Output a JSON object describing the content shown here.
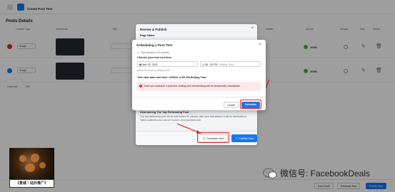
{
  "topbar": {
    "breadcrumb": "",
    "title": "Create Post Test"
  },
  "page": {
    "section_title": "Posts Details",
    "columns": [
      "Content Type",
      "Thumbnail",
      "Title",
      "Details",
      "Upload",
      "Default",
      "Edit",
      "Delete"
    ],
    "rows": [
      {
        "type": "Image",
        "upload": "100%",
        "dot_color": "#e02424"
      },
      {
        "type": "Image",
        "upload": "100%",
        "dot_color": "#1877f2"
      }
    ],
    "sub_actions": [
      "Duplicate",
      "Edit"
    ]
  },
  "review_modal": {
    "title": "Review & Publish",
    "page_name_label": "Page Name",
    "determine_title": "Determining The Top Performing Post",
    "determine_desc": "The top performing post will be determined 30 minutes after your test started. It will be distributed to Talent audiences and can be found in your published tab.",
    "schedule_label": "Schedule Test",
    "publish_label": "Publish Test"
  },
  "schedule_modal": {
    "title": "Scheduling a Post Test",
    "duration": "Test duration: 30 minutes",
    "choose_label": "Choose your test end time.",
    "date_value": "Mar 25, 2022",
    "time_value": "08 : 00 PM",
    "timezone": "Beijing Time",
    "hint": "Dates are shown in Beijing Time",
    "start_line": "Test start date and time: 3/25/22, 9:59 PM Beijing Time",
    "warning": "Once you schedule a post test, editing and rescheduling will be temporarily unavailable.",
    "cancel_label": "Cancel",
    "schedule_label": "Schedule"
  },
  "footer": {
    "save_draft": "Save Draft",
    "schedule_test": "Schedule Test",
    "publish_test": "Publish Test"
  },
  "watermark": {
    "caption": "《景城｜站外推广》",
    "wechat_text": "微信号: FacebookDeals"
  },
  "colors": {
    "accent": "#1877f2",
    "highlight": "#e02424",
    "success": "#42b72a"
  }
}
